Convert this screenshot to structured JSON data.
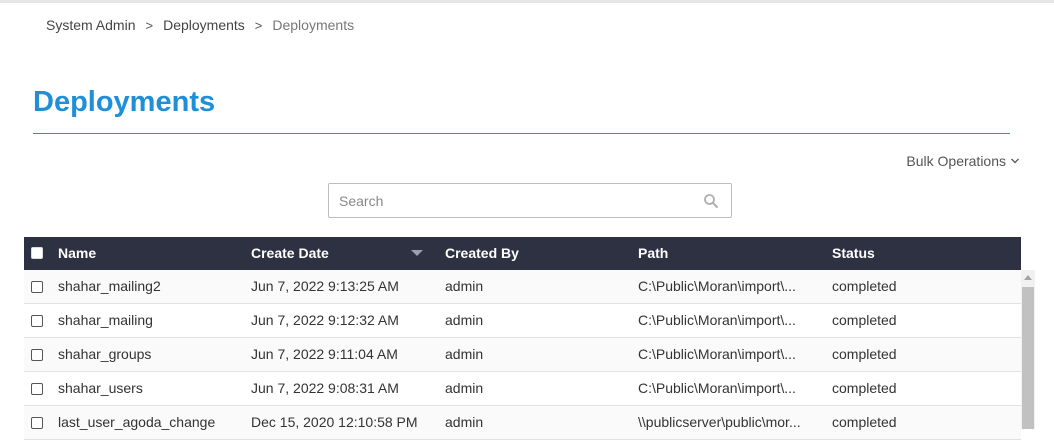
{
  "breadcrumb": {
    "items": [
      "System Admin",
      "Deployments"
    ],
    "current": "Deployments",
    "separator": ">"
  },
  "page": {
    "title": "Deployments"
  },
  "toolbar": {
    "bulk_label": "Bulk Operations",
    "bulk_icon": "chevron-down-icon"
  },
  "search": {
    "placeholder": "Search",
    "value": "",
    "icon": "search-icon"
  },
  "table": {
    "columns": [
      "Name",
      "Create Date",
      "Created By",
      "Path",
      "Status"
    ],
    "sort": {
      "column": "Create Date",
      "direction": "descending"
    },
    "rows": [
      {
        "name": "shahar_mailing2",
        "date": "Jun 7, 2022 9:13:25 AM",
        "by": "admin",
        "path": "C:\\Public\\Moran\\import\\...",
        "status": "completed"
      },
      {
        "name": "shahar_mailing",
        "date": "Jun 7, 2022 9:12:32 AM",
        "by": "admin",
        "path": "C:\\Public\\Moran\\import\\...",
        "status": "completed"
      },
      {
        "name": "shahar_groups",
        "date": "Jun 7, 2022 9:11:04 AM",
        "by": "admin",
        "path": "C:\\Public\\Moran\\import\\...",
        "status": "completed"
      },
      {
        "name": "shahar_users",
        "date": "Jun 7, 2022 9:08:31 AM",
        "by": "admin",
        "path": "C:\\Public\\Moran\\import\\...",
        "status": "completed"
      },
      {
        "name": "last_user_agoda_change",
        "date": "Dec 15, 2020 12:10:58 PM",
        "by": "admin",
        "path": "\\\\publicserver\\public\\mor...",
        "status": "completed"
      }
    ]
  },
  "colors": {
    "accent": "#1e8fd8",
    "header_bg": "#2d3142",
    "rule": "#2a8fcf"
  }
}
